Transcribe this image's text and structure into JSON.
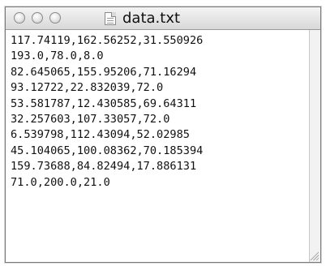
{
  "window": {
    "title": "data.txt"
  },
  "content": {
    "lines": [
      "117.74119,162.56252,31.550926",
      "193.0,78.0,8.0",
      "82.645065,155.95206,71.16294",
      "93.12722,22.832039,72.0",
      "53.581787,12.430585,69.64311",
      "32.257603,107.33057,72.0",
      "6.539798,112.43094,52.02985",
      "45.104065,100.08362,70.185394",
      "159.73688,84.82494,17.886131",
      "71.0,200.0,21.0"
    ]
  },
  "icons": {
    "close": "close-button-icon",
    "minimize": "minimize-button-icon",
    "zoom": "zoom-button-icon",
    "document": "text-document-icon",
    "resize": "resize-grip-icon"
  }
}
